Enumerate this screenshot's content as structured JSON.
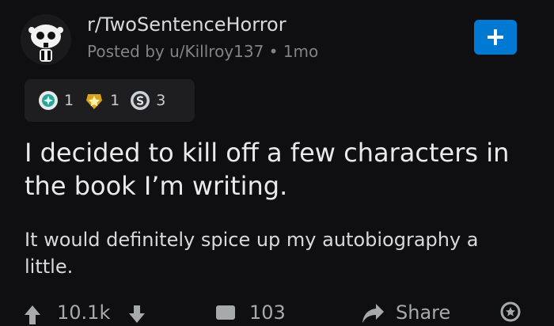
{
  "post": {
    "subreddit": "r/TwoSentenceHorror",
    "meta": "Posted by u/Killroy137 • 1mo",
    "title": "I decided to kill off a few characters in the book I’m writing.",
    "body": "It would definitely spice up my autobiography a little."
  },
  "awards": [
    {
      "icon": "helpful-award-icon",
      "count": "1"
    },
    {
      "icon": "gold-star-award-icon",
      "count": "1"
    },
    {
      "icon": "silver-coin-award-icon",
      "count": "3"
    }
  ],
  "actions": {
    "score": "10.1k",
    "comments": "103",
    "share_label": "Share"
  },
  "colors": {
    "background": "#0f0f11",
    "join_button": "#0079d3",
    "meta_text": "#818384"
  }
}
